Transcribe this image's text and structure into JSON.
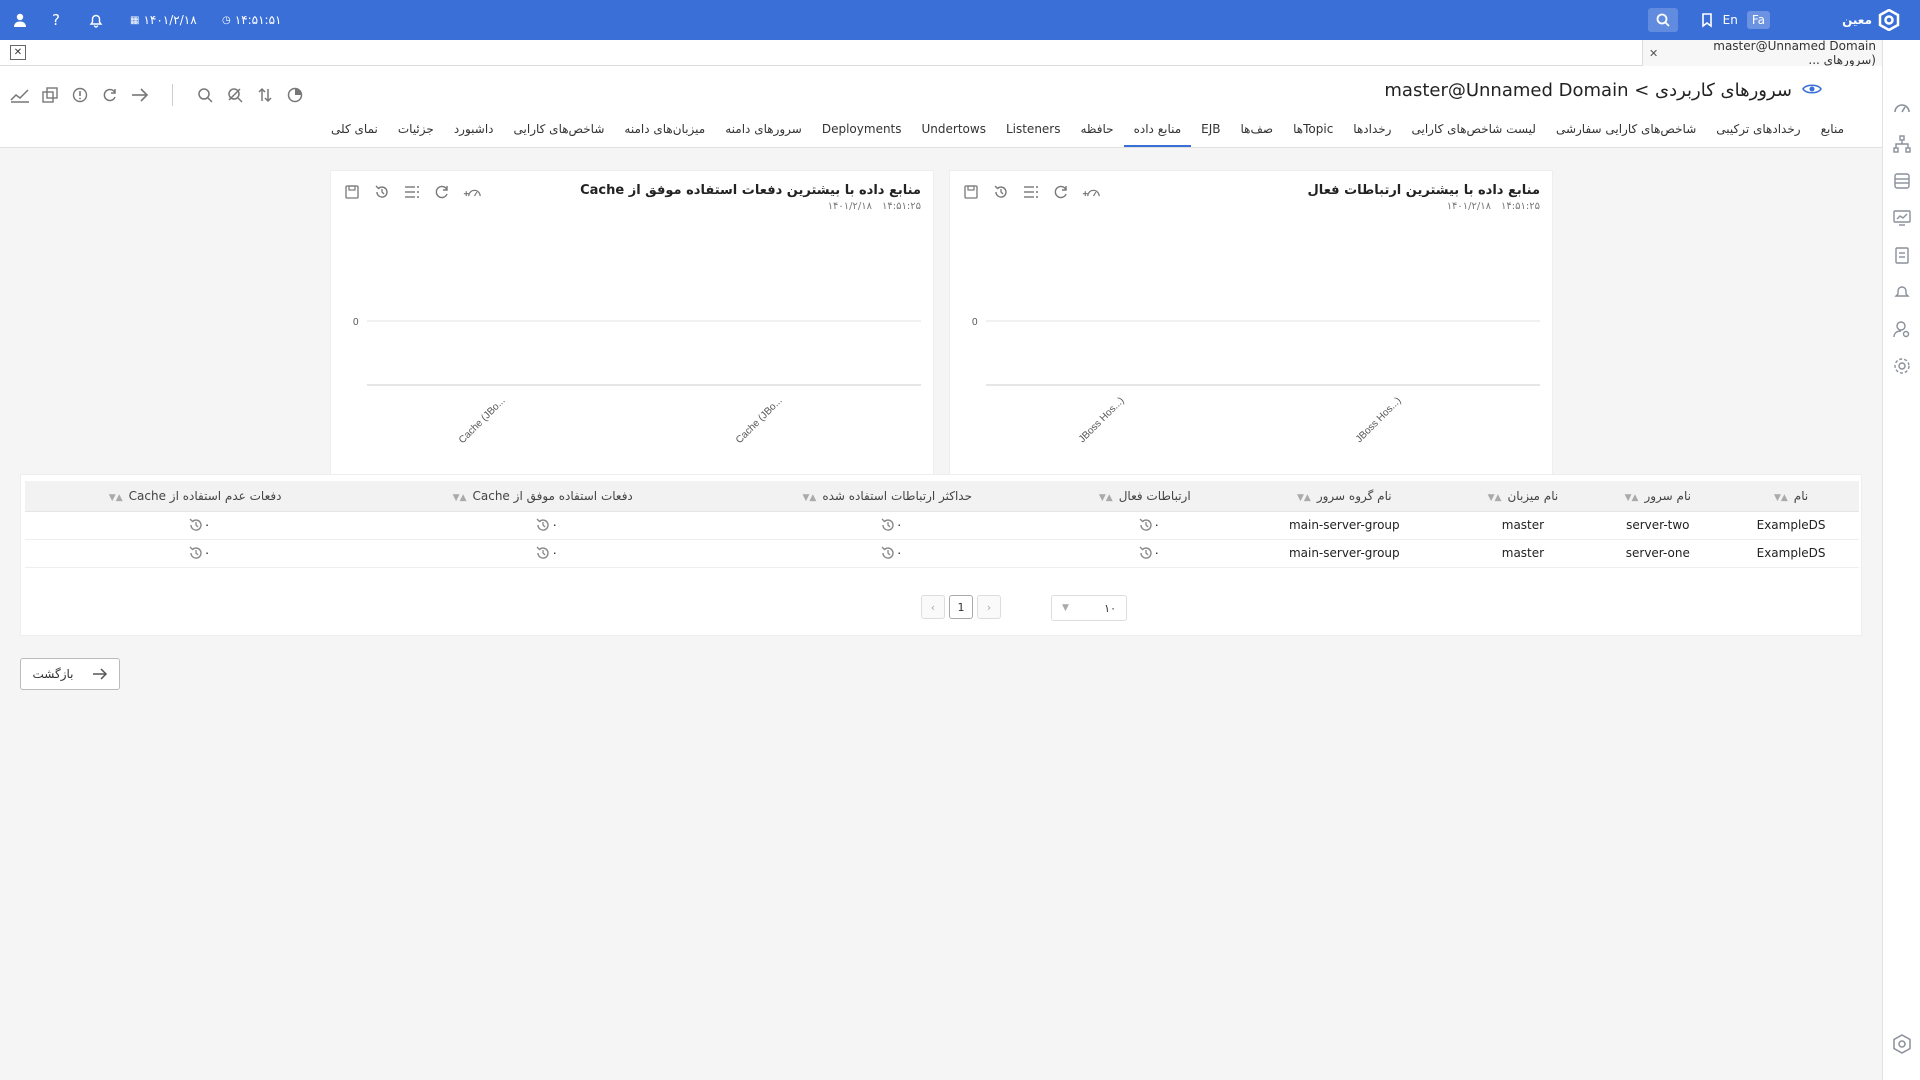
{
  "topbar": {
    "brand": "معین",
    "lang_en": "En",
    "lang_fa": "Fa",
    "time": "۱۴:۵۱:۵۱",
    "date": "۱۴۰۱/۲/۱۸"
  },
  "tabstrip": {
    "open_tab": "master@Unnamed Domain (سرورهای ..."
  },
  "page": {
    "title": "سرورهای کاربردی > master@Unnamed Domain"
  },
  "navtabs": [
    "نمای کلی",
    "جزئیات",
    "داشبورد",
    "شاخص‌های کارایی",
    "میزبان‌های دامنه",
    "سرورهای دامنه",
    "Deployments",
    "Undertows",
    "Listeners",
    "حافظه",
    "منابع داده",
    "EJB",
    "صف‌ها",
    "Topicها",
    "رخدادها",
    "لیست شاخص‌های کارایی",
    "شاخص‌های کارایی سفارشی",
    "رخدادهای ترکیبی",
    "منابع"
  ],
  "active_tab": "منابع داده",
  "cards": [
    {
      "title": "منابع داده با بیشترین ارتباطات فعال",
      "time": "۱۴:۵۱:۲۵",
      "date": "۱۴۰۱/۲/۱۸"
    },
    {
      "title": "منابع داده با بیشترین دفعات استفاده موفق از Cache",
      "time": "۱۴:۵۱:۲۵",
      "date": "۱۴۰۱/۲/۱۸"
    }
  ],
  "chart_data": [
    {
      "type": "bar",
      "title": "منابع داده با بیشترین ارتباطات فعال",
      "categories": [
        "JBoss Hos...)",
        "JBoss Hos...)"
      ],
      "values": [
        0,
        0
      ],
      "yticks": [
        "0"
      ]
    },
    {
      "type": "bar",
      "title": "منابع داده با بیشترین دفعات استفاده موفق از Cache",
      "categories": [
        "Cache (JBo...",
        "Cache (JBo..."
      ],
      "values": [
        0,
        0
      ],
      "yticks": [
        "0"
      ]
    }
  ],
  "table": {
    "headers": [
      "نام",
      "نام سرور",
      "نام میزبان",
      "نام گروه سرور",
      "ارتباطات فعال",
      "حداکثر ارتباطات استفاده شده",
      "دفعات استفاده موفق از Cache",
      "دفعات عدم استفاده از Cache"
    ],
    "rows": [
      [
        "ExampleDS",
        "server-two",
        "master",
        "main-server-group",
        "۰",
        "۰",
        "۰",
        "۰"
      ],
      [
        "ExampleDS",
        "server-one",
        "master",
        "main-server-group",
        "۰",
        "۰",
        "۰",
        "۰"
      ]
    ]
  },
  "pager": {
    "current": "1",
    "page_size": "۱۰"
  },
  "back_label": "بازگشت"
}
